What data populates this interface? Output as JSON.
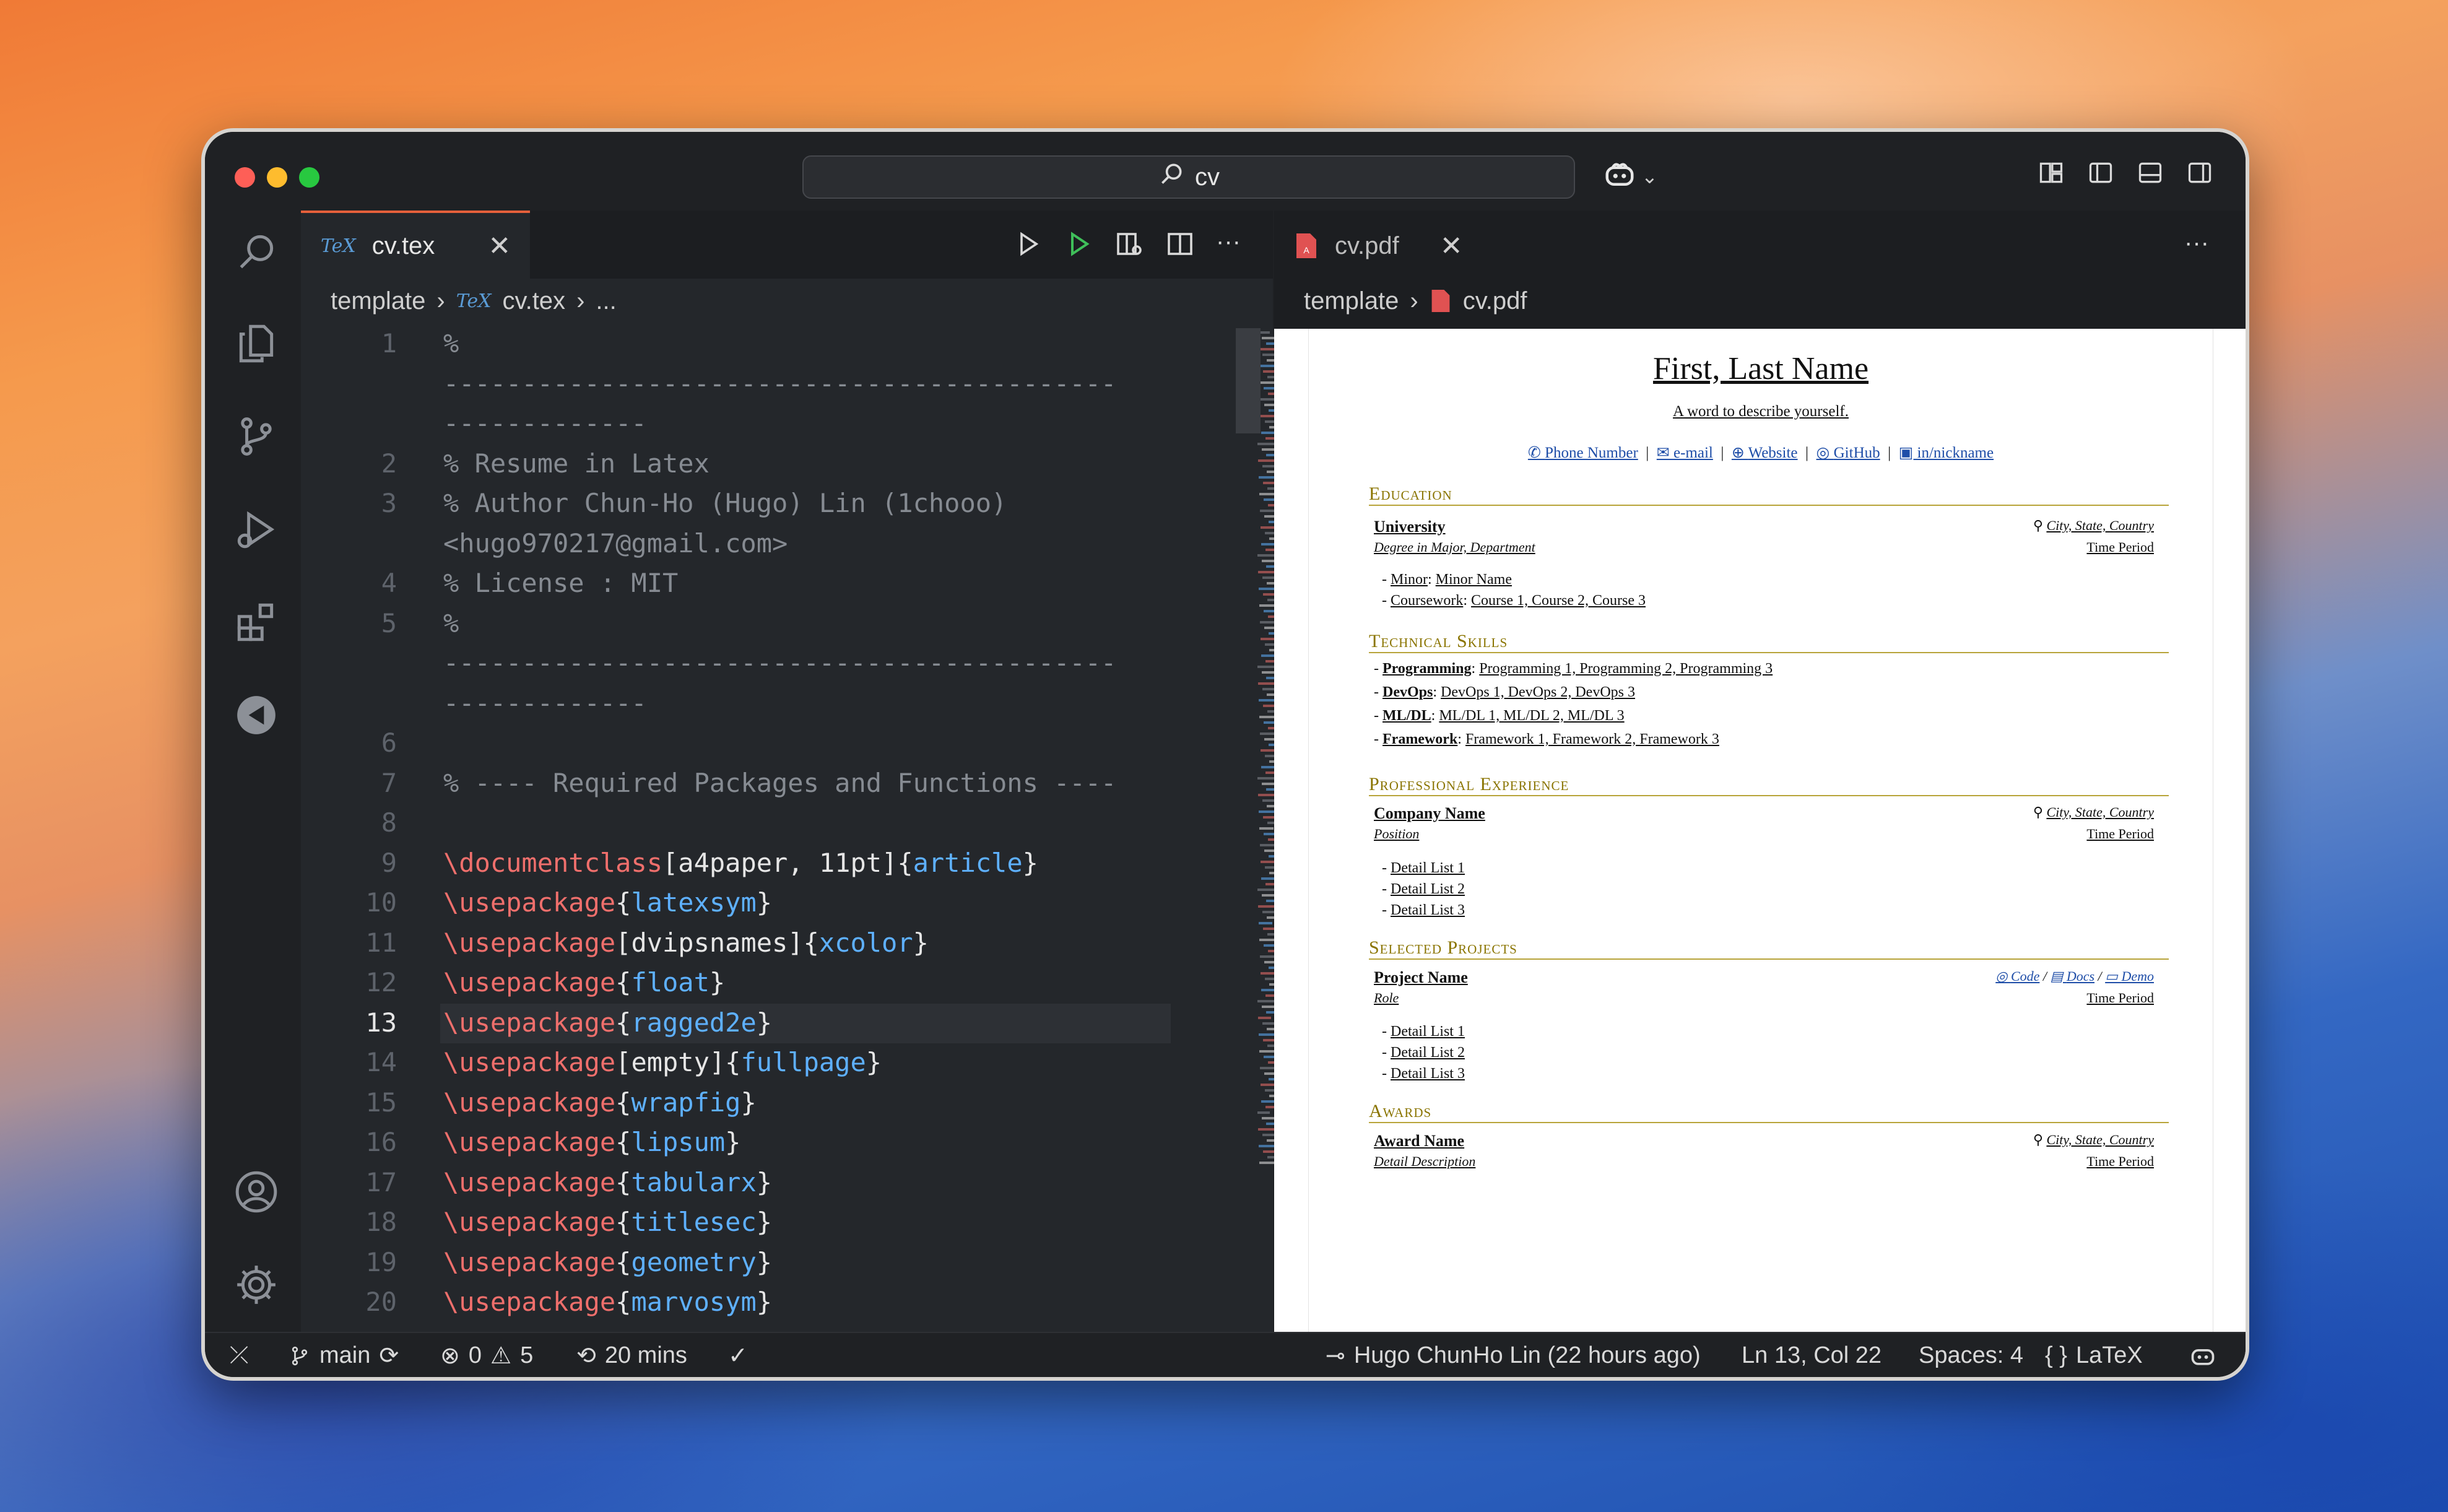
{
  "window": {
    "search_text": "cv"
  },
  "editor": {
    "tab_label": "cv.tex",
    "tab_icon": "TeX",
    "breadcrumb": {
      "folder": "template",
      "file": "cv.tex",
      "more": "..."
    },
    "lines": [
      {
        "n": "1",
        "text": "%"
      },
      {
        "n": "",
        "text": "-------------------------------------------"
      },
      {
        "n": "",
        "text": "-------------"
      },
      {
        "n": "2",
        "text": "% Resume in Latex"
      },
      {
        "n": "3",
        "text": "% Author Chun-Ho (Hugo) Lin (1chooo)"
      },
      {
        "n": "",
        "text": "<hugo970217@gmail.com>"
      },
      {
        "n": "4",
        "text": "% License : MIT"
      },
      {
        "n": "5",
        "text": "%"
      },
      {
        "n": "",
        "text": "-------------------------------------------"
      },
      {
        "n": "",
        "text": "-------------"
      },
      {
        "n": "6",
        "text": ""
      },
      {
        "n": "7",
        "text": "% ---- Required Packages and Functions ----"
      },
      {
        "n": "8",
        "text": ""
      },
      {
        "n": "9",
        "cmd": "\\documentclass",
        "opt": "[a4paper, 11pt]",
        "arg": "article"
      },
      {
        "n": "10",
        "cmd": "\\usepackage",
        "arg": "latexsym"
      },
      {
        "n": "11",
        "cmd": "\\usepackage",
        "opt": "[dvipsnames]",
        "arg": "xcolor"
      },
      {
        "n": "12",
        "cmd": "\\usepackage",
        "arg": "float"
      },
      {
        "n": "13",
        "cmd": "\\usepackage",
        "arg": "ragged2e"
      },
      {
        "n": "14",
        "cmd": "\\usepackage",
        "opt": "[empty]",
        "arg": "fullpage"
      },
      {
        "n": "15",
        "cmd": "\\usepackage",
        "arg": "wrapfig"
      },
      {
        "n": "16",
        "cmd": "\\usepackage",
        "arg": "lipsum"
      },
      {
        "n": "17",
        "cmd": "\\usepackage",
        "arg": "tabularx"
      },
      {
        "n": "18",
        "cmd": "\\usepackage",
        "arg": "titlesec"
      },
      {
        "n": "19",
        "cmd": "\\usepackage",
        "arg": "geometry"
      },
      {
        "n": "20",
        "cmd": "\\usepackage",
        "arg": "marvosym"
      }
    ],
    "current_line": "13"
  },
  "pdf": {
    "tab_label": "cv.pdf",
    "breadcrumb": {
      "folder": "template",
      "file": "cv.pdf"
    },
    "name": "First, Last Name",
    "tagline": "A word to describe yourself.",
    "contacts": [
      "Phone Number",
      "e-mail",
      "Website",
      "GitHub",
      "in/nickname"
    ],
    "sections": {
      "education": "Education",
      "skills": "Technical Skills",
      "experience": "Professional Experience",
      "projects": "Selected Projects",
      "awards": "Awards"
    },
    "edu": {
      "school": "University",
      "location": "City, State, Country",
      "degree": "Degree in Major, Department",
      "time": "Time Period",
      "minor_label": "Minor",
      "minor": "Minor Name",
      "course_label": "Coursework",
      "courses": "Course 1, Course 2, Course 3"
    },
    "skills": [
      {
        "label": "Programming",
        "items": "Programming 1, Programming 2, Programming 3"
      },
      {
        "label": "DevOps",
        "items": "DevOps 1, DevOps 2, DevOps 3"
      },
      {
        "label": "ML/DL",
        "items": "ML/DL 1, ML/DL 2, ML/DL 3"
      },
      {
        "label": "Framework",
        "items": "Framework 1, Framework 2, Framework 3"
      }
    ],
    "exp": {
      "company": "Company Name",
      "location": "City, State, Country",
      "position": "Position",
      "time": "Time Period",
      "details": [
        "Detail List 1",
        "Detail List 2",
        "Detail List 3"
      ]
    },
    "proj": {
      "name": "Project Name",
      "links": [
        "Code",
        "Docs",
        "Demo"
      ],
      "role": "Role",
      "time": "Time Period",
      "details": [
        "Detail List 1",
        "Detail List 2",
        "Detail List 3"
      ]
    },
    "award": {
      "name": "Award Name",
      "location": "City, State, Country",
      "desc": "Detail Description",
      "time": "Time Period"
    }
  },
  "status": {
    "branch": "main",
    "errors": "0",
    "warnings": "5",
    "time": "20 mins",
    "blame": "Hugo ChunHo Lin (22 hours ago)",
    "position": "Ln 13, Col 22",
    "spaces": "Spaces: 4",
    "language": "LaTeX"
  },
  "colors": {
    "accent_tab": "#e5603b",
    "latex_cmd": "#ef6f6c",
    "latex_arg": "#5eb0ff",
    "section": "#8a7400"
  }
}
